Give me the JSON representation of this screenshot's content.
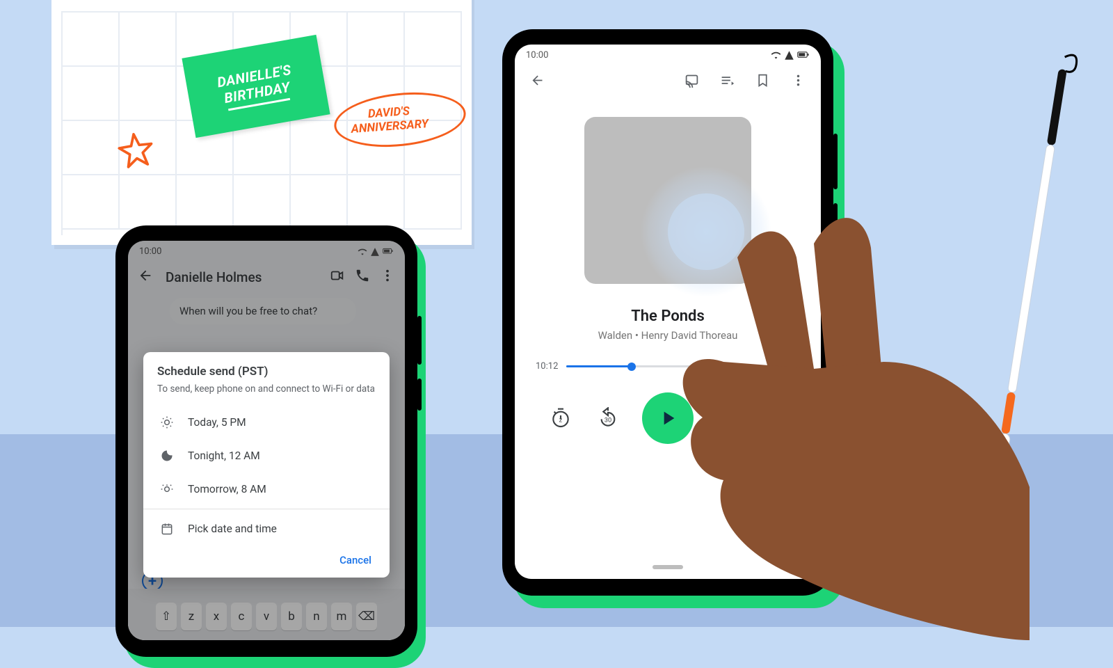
{
  "calendar": {
    "sticky_line1": "DANIELLE'S",
    "sticky_line2": "BIRTHDAY",
    "anniversary_line1": "DAVID'S",
    "anniversary_line2": "ANNIVERSARY"
  },
  "left_phone": {
    "status_time": "10:00",
    "chat_title": "Danielle Holmes",
    "incoming_message": "When will you be free to chat?",
    "sheet": {
      "title": "Schedule send (PST)",
      "subtitle": "To send, keep phone on and connect to Wi-Fi or data",
      "options": [
        "Today, 5 PM",
        "Tonight, 12 AM",
        "Tomorrow, 8 AM",
        "Pick date and time"
      ],
      "cancel": "Cancel"
    },
    "keyboard_keys": [
      "z",
      "x",
      "c",
      "v",
      "b",
      "n",
      "m"
    ]
  },
  "right_phone": {
    "status_time": "10:00",
    "track_title": "The Ponds",
    "track_subtitle": "Walden • Henry David Thoreau",
    "elapsed": "10:12"
  }
}
